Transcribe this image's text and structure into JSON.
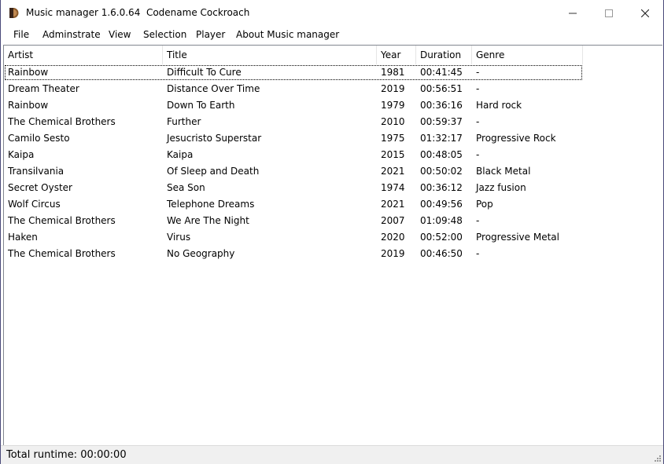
{
  "window": {
    "title": "Music manager 1.6.0.64  Codename Cockroach",
    "icon": "app-icon",
    "controls": {
      "minimize": "minimize-icon",
      "maximize": "maximize-icon",
      "close": "close-icon"
    }
  },
  "menu": {
    "items": [
      {
        "label": "File"
      },
      {
        "label": "Adminstrate"
      },
      {
        "label": "View"
      },
      {
        "label": "Selection"
      },
      {
        "label": "Player"
      },
      {
        "label": "About Music manager"
      }
    ]
  },
  "table": {
    "columns": [
      {
        "label": "Artist"
      },
      {
        "label": "Title"
      },
      {
        "label": "Year"
      },
      {
        "label": "Duration"
      },
      {
        "label": "Genre"
      }
    ],
    "rows": [
      [
        "Rainbow",
        "Difficult To Cure",
        "1981",
        "00:41:45",
        "-"
      ],
      [
        "Dream Theater",
        "Distance Over Time",
        "2019",
        "00:56:51",
        "-"
      ],
      [
        "Rainbow",
        "Down To Earth",
        "1979",
        "00:36:16",
        "Hard rock"
      ],
      [
        "The Chemical Brothers",
        "Further",
        "2010",
        "00:59:37",
        "-"
      ],
      [
        "Camilo Sesto",
        "Jesucristo Superstar",
        "1975",
        "01:32:17",
        "Progressive Rock"
      ],
      [
        "Kaipa",
        "Kaipa",
        "2015",
        "00:48:05",
        "-"
      ],
      [
        "Transilvania",
        "Of Sleep and Death",
        "2021",
        "00:50:02",
        "Black Metal"
      ],
      [
        "Secret Oyster",
        "Sea Son",
        "1974",
        "00:36:12",
        "Jazz fusion"
      ],
      [
        "Wolf Circus",
        "Telephone Dreams",
        "2021",
        "00:49:56",
        "Pop"
      ],
      [
        "The Chemical Brothers",
        "We Are The Night",
        "2007",
        "01:09:48",
        "-"
      ],
      [
        "Haken",
        "Virus",
        "2020",
        "00:52:00",
        "Progressive Metal"
      ],
      [
        "The Chemical Brothers",
        "No Geography",
        "2019",
        "00:46:50",
        "-"
      ]
    ],
    "focused_row": 0
  },
  "status": {
    "text": "Total runtime: 00:00:00"
  }
}
